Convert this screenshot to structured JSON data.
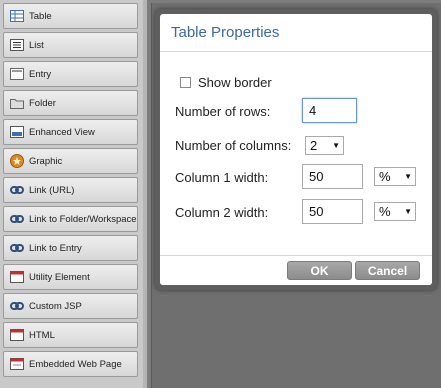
{
  "palette": {
    "items": [
      {
        "label": "Table",
        "icon": "table-icon"
      },
      {
        "label": "List",
        "icon": "list-icon"
      },
      {
        "label": "Entry",
        "icon": "entry-icon"
      },
      {
        "label": "Folder",
        "icon": "folder-icon"
      },
      {
        "label": "Enhanced View",
        "icon": "enhanced-view-icon"
      },
      {
        "label": "Graphic",
        "icon": "graphic-icon"
      },
      {
        "label": "Link (URL)",
        "icon": "link-icon"
      },
      {
        "label": "Link to Folder/Workspace",
        "icon": "link-icon"
      },
      {
        "label": "Link to Entry",
        "icon": "link-icon"
      },
      {
        "label": "Utility Element",
        "icon": "utility-element-icon"
      },
      {
        "label": "Custom JSP",
        "icon": "link-icon"
      },
      {
        "label": "HTML",
        "icon": "html-icon"
      },
      {
        "label": "Embedded Web Page",
        "icon": "embedded-web-page-icon"
      }
    ]
  },
  "dialog": {
    "title": "Table Properties",
    "show_border_label": "Show border",
    "show_border_checked": false,
    "rows_label": "Number of rows:",
    "rows_value": "4",
    "columns_label": "Number of columns:",
    "columns_value": "2",
    "col1_label": "Column 1 width:",
    "col1_value": "50",
    "col1_unit": "%",
    "col2_label": "Column 2 width:",
    "col2_value": "50",
    "col2_unit": "%",
    "ok_label": "OK",
    "cancel_label": "Cancel"
  },
  "colors": {
    "title": "#3a6aa0",
    "button": "#9a9a9a",
    "backdrop": "#7a7a7a"
  }
}
